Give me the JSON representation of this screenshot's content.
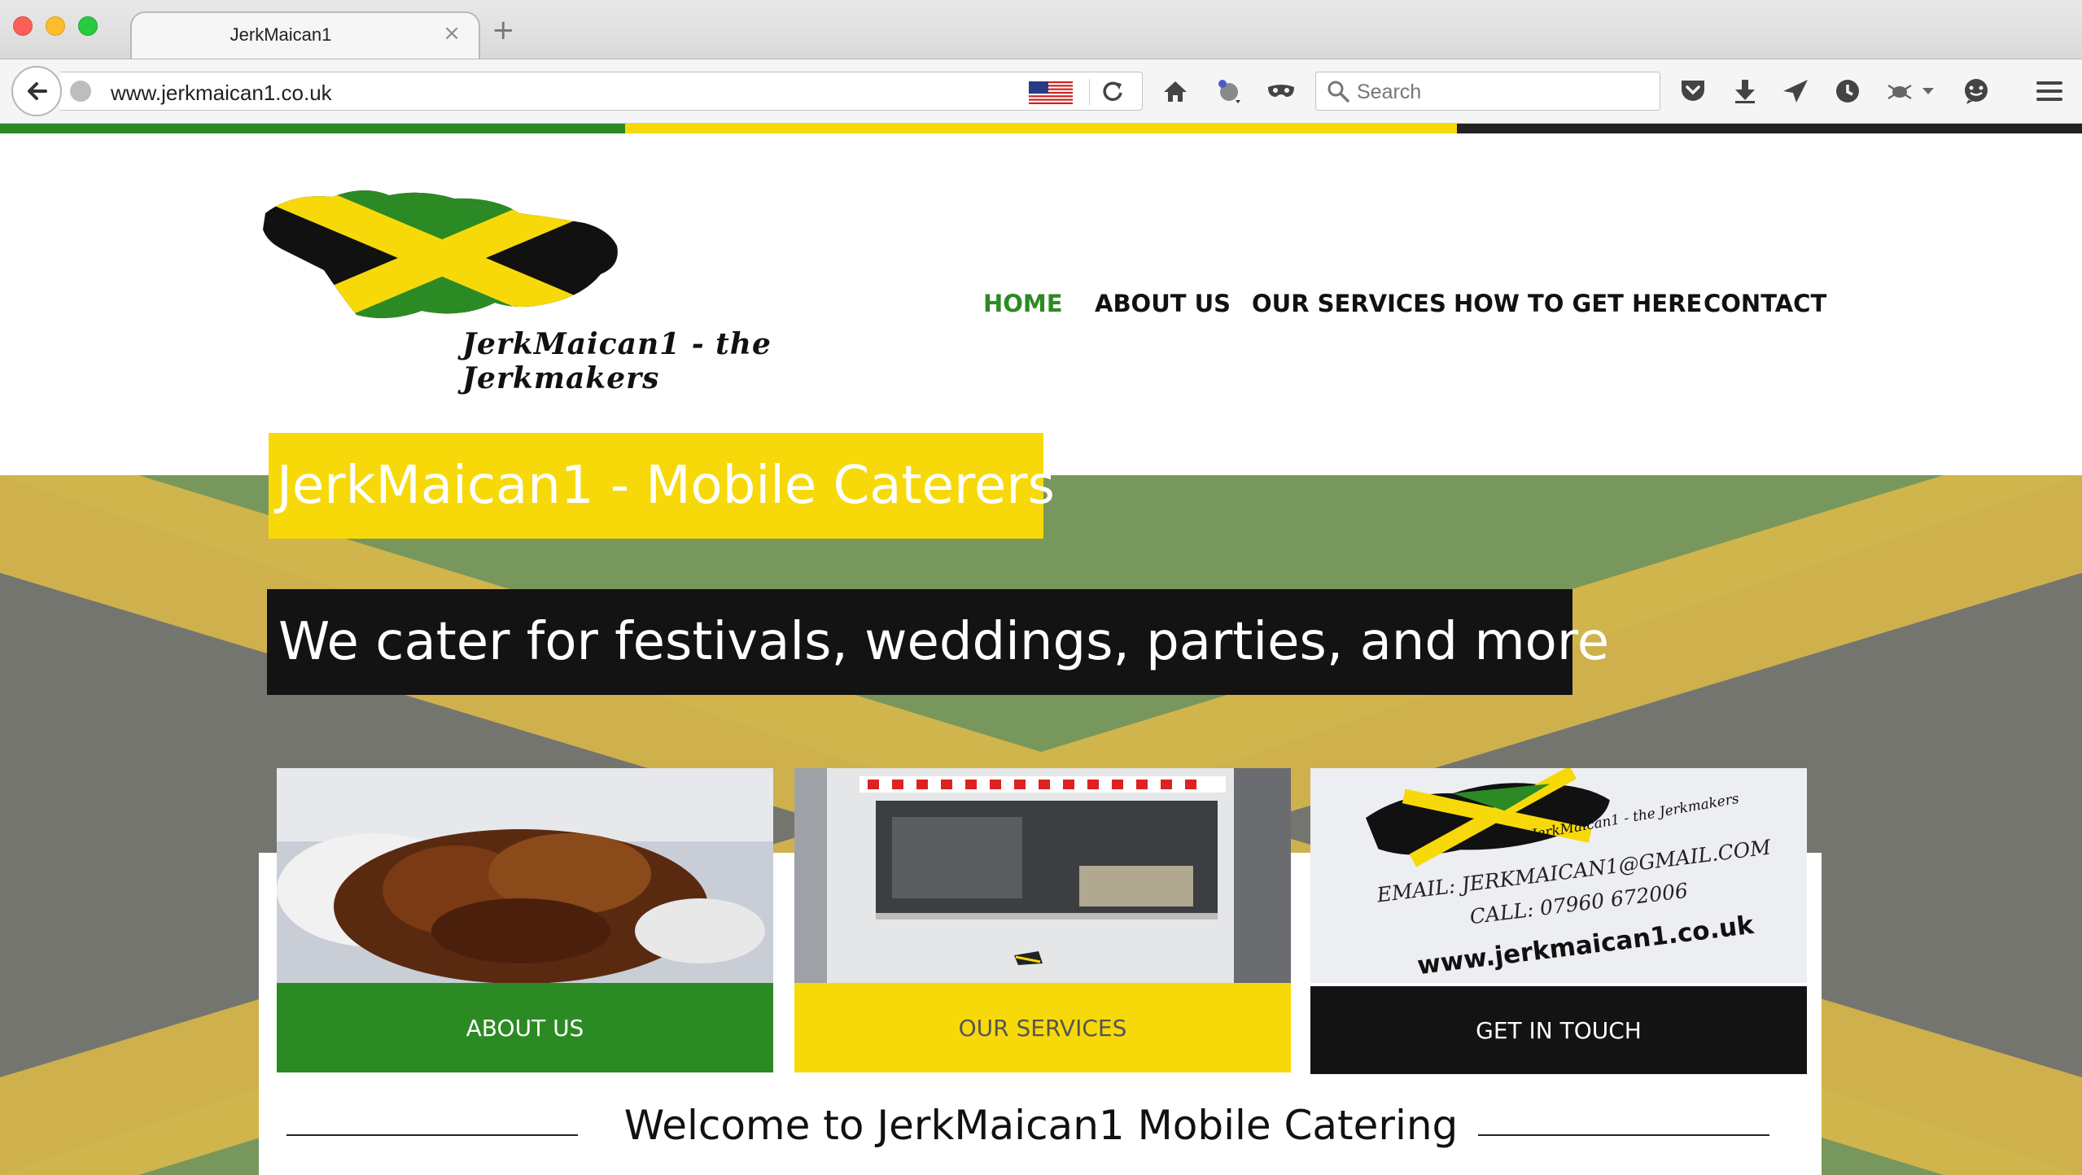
{
  "browser": {
    "tab_title": "JerkMaican1",
    "tab_close": "×",
    "new_tab": "+",
    "url": "www.jerkmaican1.co.uk",
    "search_placeholder": "Search",
    "icons": [
      "back-arrow-icon",
      "globe-icon",
      "us-flag-icon",
      "reload-icon",
      "home-icon",
      "extension-icon",
      "mask-icon",
      "search-icon",
      "pocket-icon",
      "download-icon",
      "send-icon",
      "history-icon",
      "bug-icon",
      "dropdown-icon",
      "chat-icon",
      "menu-icon"
    ]
  },
  "theme": {
    "green": "#2c8a24",
    "yellow": "#f7d90a",
    "black": "#131313"
  },
  "site": {
    "logo_text": "JerkMaican1 - the Jerkmakers",
    "nav": [
      {
        "label": "HOME",
        "active": true
      },
      {
        "label": "ABOUT US",
        "active": false
      },
      {
        "label": "OUR SERVICES",
        "active": false
      },
      {
        "label": "HOW TO GET HERE",
        "active": false
      },
      {
        "label": "CONTACT",
        "active": false
      }
    ],
    "hero_title": "JerkMaican1 - Mobile Caterers",
    "hero_subtitle": "We cater for festivals, weddings, parties, and more",
    "cards": [
      {
        "button": "ABOUT US",
        "image": "jerk-chicken-photo"
      },
      {
        "button": "OUR SERVICES",
        "image": "catering-van-photo"
      },
      {
        "button": "GET IN TOUCH",
        "image": "business-card-photo",
        "card_brand": "JerkMaican1 - the Jerkmakers",
        "card_email": "EMAIL: JERKMAICAN1@GMAIL.COM",
        "card_call": "CALL: 07960 672006",
        "card_web": "www.jerkmaican1.co.uk"
      }
    ],
    "welcome": "Welcome to JerkMaican1 Mobile Catering"
  }
}
